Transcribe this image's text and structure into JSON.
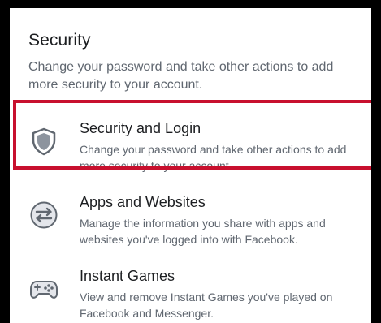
{
  "section": {
    "title": "Security",
    "description": "Change your password and take other actions to add more security to your account."
  },
  "items": [
    {
      "title": "Security and Login",
      "description": "Change your password and take other actions to add more security to your account.",
      "icon": "shield-icon",
      "highlighted": true
    },
    {
      "title": "Apps and Websites",
      "description": "Manage the information you share with apps and websites you've logged into with Facebook.",
      "icon": "exchange-arrows-icon"
    },
    {
      "title": "Instant Games",
      "description": "View and remove Instant Games you've played on Facebook and Messenger.",
      "icon": "gamepad-icon"
    }
  ],
  "colors": {
    "highlight_border": "#c8102e",
    "icon_fill": "#8d949e",
    "title_text": "#1c1e21",
    "secondary_text": "#606770"
  }
}
